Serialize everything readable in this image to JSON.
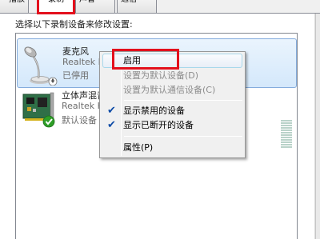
{
  "tabs": [
    {
      "label": "播放",
      "active": false
    },
    {
      "label": "录制",
      "active": true
    },
    {
      "label": "声音",
      "active": false
    },
    {
      "label": "通信",
      "active": false
    }
  ],
  "instruction": "选择以下录制设备来修改设置:",
  "devices": [
    {
      "name": "麦克风",
      "driver": "Realtek H",
      "status": "已停用",
      "icon": "microphone-icon",
      "selected": true
    },
    {
      "name": "立体声混音",
      "driver": "Realtek H",
      "status": "默认设备",
      "icon": "sound-card-icon",
      "selected": false
    }
  ],
  "context_menu": {
    "items": [
      {
        "label": "启用",
        "enabled": true,
        "checked": false
      },
      {
        "label": "设置为默认设备(D)",
        "enabled": false,
        "checked": false
      },
      {
        "label": "设置为默认通信设备(C)",
        "enabled": false,
        "checked": false
      },
      {
        "label": "显示禁用的设备",
        "enabled": true,
        "checked": true
      },
      {
        "label": "显示已断开的设备",
        "enabled": true,
        "checked": true
      },
      {
        "label": "属性(P)",
        "enabled": true,
        "checked": false
      }
    ]
  },
  "colors": {
    "highlight_box": "#e3101d",
    "selection_border": "#84acdd",
    "check": "#0c4aa6",
    "default_badge": "#2e9e27"
  }
}
